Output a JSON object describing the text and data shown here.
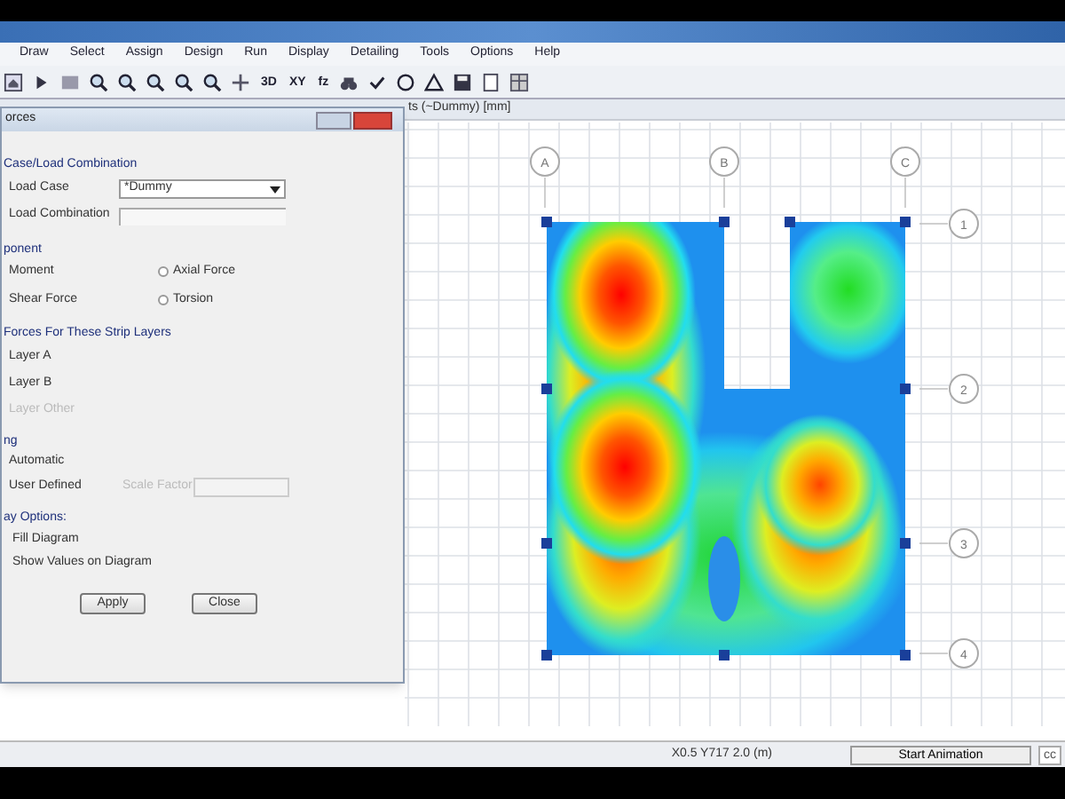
{
  "menu": [
    "Draw",
    "Select",
    "Assign",
    "Design",
    "Run",
    "Display",
    "Detailing",
    "Tools",
    "Options",
    "Help"
  ],
  "toolbar": {
    "text_buttons": [
      "3D",
      "XY",
      "fz"
    ]
  },
  "view_title": "ts (~Dummy) [mm]",
  "grid_bubbles": {
    "columns": [
      "A",
      "B",
      "C"
    ],
    "rows": [
      "1",
      "2",
      "3",
      "4"
    ]
  },
  "dialog": {
    "title": "orces",
    "case_group": "Case/Load Combination",
    "load_case": {
      "label": "Load Case",
      "value": "*Dummy"
    },
    "load_combination": {
      "label": "Load Combination"
    },
    "component_group": "ponent",
    "components": [
      {
        "label": "Moment"
      },
      {
        "label": "Shear Force"
      },
      {
        "label": "Axial Force",
        "selected": false
      },
      {
        "label": "Torsion",
        "selected": false
      }
    ],
    "layers_group": "Forces For These Strip Layers",
    "layers": [
      {
        "label": "Layer A",
        "disabled": false
      },
      {
        "label": "Layer B",
        "disabled": false
      },
      {
        "label": "Layer Other",
        "disabled": true
      }
    ],
    "scaling_group": "ng",
    "scaling": [
      {
        "label": "Automatic"
      },
      {
        "label": "User Defined"
      }
    ],
    "scale_factor": {
      "label": "Scale Factor",
      "disabled": true
    },
    "display_group": "ay Options:",
    "display_options": [
      "Fill Diagram",
      "Show Values on Diagram"
    ],
    "buttons": [
      "Apply",
      "Close"
    ]
  },
  "status_bar": {
    "coordinates": "X0.5 Y717 2.0 (m)",
    "animation_button": "Start Animation",
    "units": "cc"
  }
}
